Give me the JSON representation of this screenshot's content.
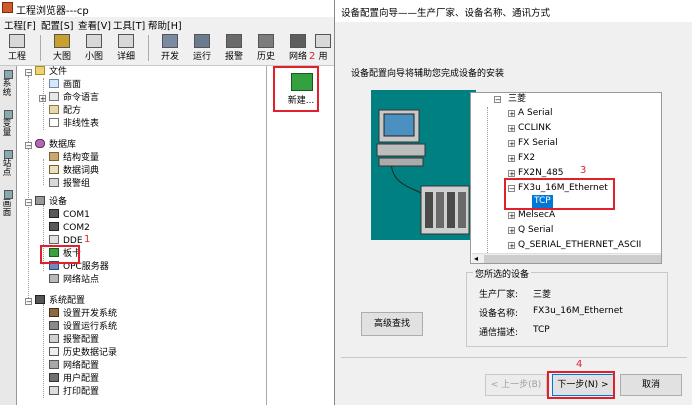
{
  "main_window": {
    "title": "工程浏览器---cp",
    "menu": [
      "工程[F]",
      "配置[S]",
      "查看[V]",
      "工具[T]",
      "帮助[H]"
    ],
    "toolbar": [
      "工程",
      "大图",
      "小图",
      "详细",
      "开发",
      "运行",
      "报警",
      "历史",
      "网络",
      "用"
    ],
    "vertical_tabs": [
      "系统",
      "变量",
      "站点",
      "画面"
    ],
    "tree": {
      "file": {
        "label": "文件",
        "children": [
          "画面",
          "命令语言",
          "配方",
          "非线性表"
        ]
      },
      "database": {
        "label": "数据库",
        "children": [
          "结构变量",
          "数据词典",
          "报警组"
        ]
      },
      "device": {
        "label": "设备",
        "children": [
          "COM1",
          "COM2",
          "DDE",
          "板卡",
          "OPC服务器",
          "网络站点"
        ]
      },
      "system_config": {
        "label": "系统配置",
        "children": [
          "设置开发系统",
          "设置运行系统",
          "报警配置",
          "历史数据记录",
          "网络配置",
          "用户配置",
          "打印配置"
        ]
      }
    },
    "right_pane": {
      "new_label": "新建..."
    }
  },
  "annotations": [
    "1",
    "2",
    "3",
    "4"
  ],
  "dialog": {
    "title": "设备配置向导——生产厂家、设备名称、通讯方式",
    "subtitle": "设备配置向导将辅助您完成设备的安装",
    "device_tree": {
      "root": "三菱",
      "items": [
        "A Serial",
        "CCLINK",
        "FX Serial",
        "FX2",
        "FX2N_485",
        "FX3u_16M_Ethernet",
        "TCP",
        "MelsecA",
        "Q Serial",
        "Q_SERIAL_ETHERNET_ASCII"
      ]
    },
    "selected_group": {
      "title": "您所选的设备",
      "manufacturer_label": "生产厂家:",
      "manufacturer_value": "三菱",
      "device_label": "设备名称:",
      "device_value": "FX3u_16M_Ethernet",
      "comm_label": "通信描述:",
      "comm_value": "TCP"
    },
    "buttons": {
      "advanced": "高级查找",
      "prev": "< 上一步(B)",
      "next": "下一步(N) >",
      "cancel": "取消"
    }
  },
  "colors": {
    "annotation_red": "#e0202a",
    "illustration_bg": "#008080",
    "selection_blue": "#0078d7"
  }
}
